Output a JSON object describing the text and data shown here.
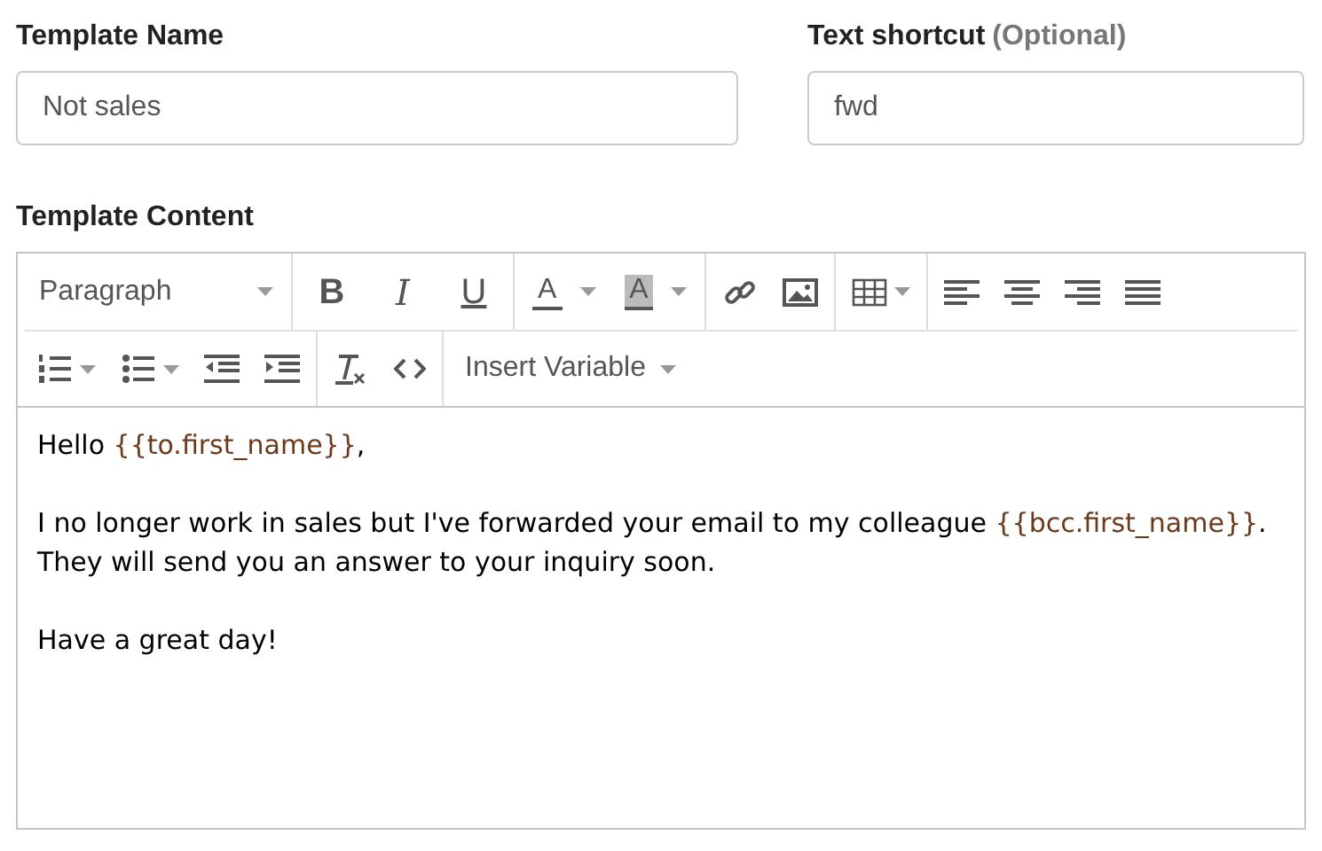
{
  "template_name": {
    "label": "Template Name",
    "value": "Not sales"
  },
  "text_shortcut": {
    "label": "Text shortcut",
    "hint": "(Optional)",
    "value": "fwd"
  },
  "template_content": {
    "label": "Template Content",
    "toolbar": {
      "block_format": "Paragraph",
      "format_buttons": [
        {
          "kind": "bold",
          "label": "B"
        },
        {
          "kind": "italic",
          "label": "I"
        },
        {
          "kind": "underline",
          "label": "U"
        }
      ],
      "color_buttons": [
        {
          "kind": "text",
          "label": "A"
        },
        {
          "kind": "background",
          "label": "A"
        }
      ],
      "insert_variable": "Insert Variable"
    },
    "paragraphs": [
      [
        {
          "kind": "text",
          "text": "Hello "
        },
        {
          "kind": "variable",
          "text": "{{to.first_name}}"
        },
        {
          "kind": "text",
          "text": ","
        }
      ],
      [
        {
          "kind": "text",
          "text": "I no longer work in sales but I've forwarded your email to my colleague "
        },
        {
          "kind": "variable",
          "text": "{{bcc.first_name}}"
        },
        {
          "kind": "text",
          "text": ". They will send you an answer to your inquiry soon."
        }
      ],
      [
        {
          "kind": "text",
          "text": "Have a great day!"
        }
      ]
    ]
  }
}
